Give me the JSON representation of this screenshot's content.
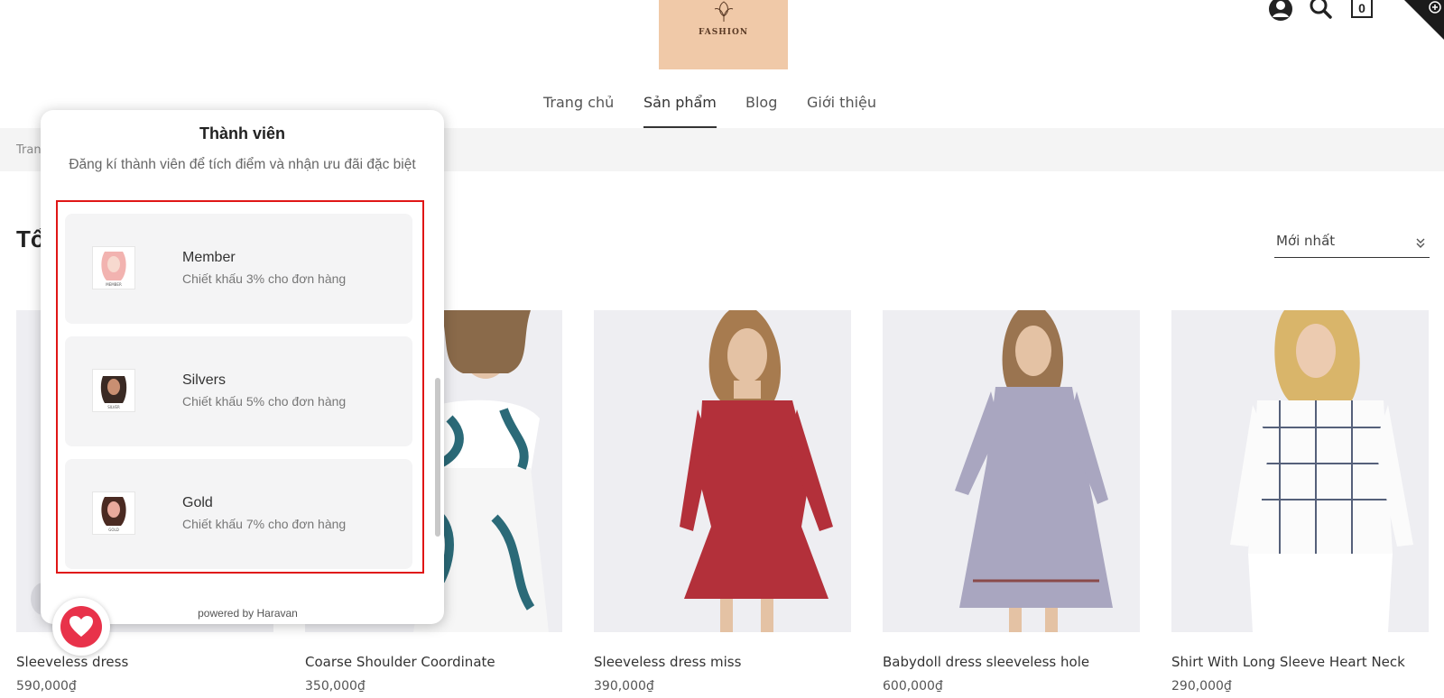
{
  "header": {
    "logo_text": "FASHION",
    "nav": [
      "Trang chủ",
      "Sản phẩm",
      "Blog",
      "Giới thiệu"
    ],
    "active_nav": "Sản phẩm",
    "cart_count": "0",
    "icons": [
      "user-icon",
      "search-icon",
      "cart-icon"
    ]
  },
  "breadcrumb": {
    "text": "Tran"
  },
  "main": {
    "title_fragment": "Tổ",
    "sort": {
      "value": "Mới nhất"
    }
  },
  "products": [
    {
      "name": "Sleeveless dress",
      "price": "590,000₫"
    },
    {
      "name": "Coarse Shoulder Coordinate",
      "price": "350,000₫"
    },
    {
      "name": "Sleeveless dress miss",
      "price": "390,000₫"
    },
    {
      "name": "Babydoll dress sleeveless hole",
      "price": "600,000₫"
    },
    {
      "name": "Shirt With Long Sleeve Heart Neck",
      "price": "290,000₫"
    }
  ],
  "membership_modal": {
    "title": "Thành viên",
    "description": "Đăng kí thành viên để tích điểm và nhận ưu đãi đặc biệt",
    "tiers": [
      {
        "name": "Member",
        "perk": "Chiết khấu 3% cho đơn hàng",
        "badge": "MEMBER"
      },
      {
        "name": "Silvers",
        "perk": "Chiết khấu 5% cho đơn hàng",
        "badge": "SILVER"
      },
      {
        "name": "Gold",
        "perk": "Chiết khấu 7% cho đơn hàng",
        "badge": "GOLD"
      }
    ],
    "footer": "powered by Haravan"
  },
  "colors": {
    "accent_red": "#e01616",
    "heart_button": "#e8324a",
    "logo_bg": "#f0c9a8"
  }
}
